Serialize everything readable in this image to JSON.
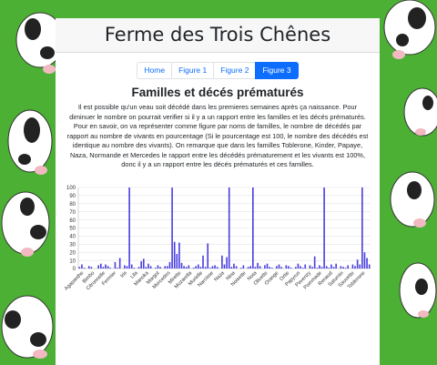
{
  "site": {
    "title": "Ferme des Trois Chênes"
  },
  "nav": {
    "tabs": [
      {
        "label": "Home",
        "active": false
      },
      {
        "label": "Figure 1",
        "active": false
      },
      {
        "label": "Figure 2",
        "active": false
      },
      {
        "label": "Figure 3",
        "active": true
      }
    ]
  },
  "section": {
    "title": "Familles et décés prématurés",
    "description": "Il est possible qu'un veau soit décédé dans les premieres semaines après ça naissance. Pour diminuer le nombre on pourrait verifier si il y a un rapport entre les familles et les décés prématurés. Pour en savoir, on va représenter comme figure par noms de familles, le nombre de décédés par rapport au nombre de vivants en pourcentage (Si le pourcentage est 100, le nombre des décédés est identique au nombre des vivants). On remarque que dans les familles Toblerone, Kinder, Papaye, Naza, Normande et Mercedes le rapport entre les décédés prématurement et les vivants est 100%, donc il y a un rapport entre les décés prématurés et ces familles."
  },
  "colors": {
    "background": "#4cb034",
    "bar": "#4a3fe0",
    "accent": "#0d6efd"
  },
  "chart_data": {
    "type": "bar",
    "ylim": [
      0,
      100
    ],
    "yticks": [
      0,
      10,
      20,
      30,
      40,
      50,
      60,
      70,
      80,
      90,
      100
    ],
    "grid": true,
    "xtick_labels": [
      "Agapanthe",
      "Bimbo",
      "Citronnelle",
      "Fermier",
      "Iris",
      "Lila",
      "Manoka",
      "Margot",
      "Mercedes",
      "Mirette",
      "Mozarella",
      "Murielle",
      "Narcisse",
      "Naza",
      "Nina",
      "Noisette",
      "Nota",
      "Olivette",
      "Orange",
      "Ortie",
      "Papyrus",
      "Pevenzy",
      "Pommade",
      "Renaud",
      "Saturnin",
      "Sauvette",
      "Toblerone"
    ],
    "values": [
      2,
      5,
      1,
      0,
      3,
      2,
      0,
      0,
      4,
      6,
      2,
      5,
      3,
      1,
      0,
      8,
      1,
      13,
      0,
      4,
      3,
      100,
      5,
      1,
      0,
      2,
      9,
      12,
      2,
      6,
      3,
      0,
      1,
      4,
      2,
      0,
      3,
      3,
      8,
      100,
      33,
      18,
      32,
      7,
      3,
      2,
      4,
      0,
      1,
      3,
      5,
      2,
      16,
      2,
      31,
      1,
      3,
      4,
      2,
      0,
      16,
      5,
      14,
      100,
      2,
      6,
      3,
      0,
      1,
      4,
      0,
      2,
      3,
      100,
      2,
      7,
      3,
      0,
      4,
      6,
      2,
      1,
      0,
      3,
      5,
      2,
      0,
      4,
      3,
      1,
      0,
      2,
      6,
      3,
      1,
      5,
      0,
      4,
      2,
      15,
      1,
      4,
      2,
      100,
      3,
      1,
      5,
      2,
      6,
      0,
      3,
      2,
      1,
      4,
      0,
      5,
      3,
      11,
      5,
      100,
      20,
      13,
      5
    ]
  }
}
